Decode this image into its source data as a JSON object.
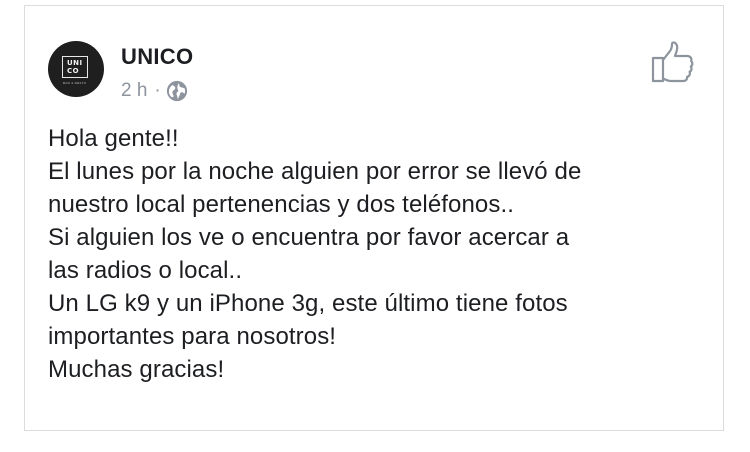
{
  "post": {
    "page_name": "UNICO",
    "timestamp": "2 h",
    "separator": "·",
    "privacy_icon": "globe-icon",
    "avatar": {
      "logo_line1": "UNI",
      "logo_line2": "CO",
      "logo_sub": "BAR & RESTO"
    },
    "like_icon": "thumbs-up-icon",
    "lines": [
      "Hola gente!!",
      "El lunes por la noche alguien por error se llevó de",
      "nuestro local pertenencias y dos teléfonos..",
      "Si alguien los ve o encuentra por favor acercar a",
      "las radios o local..",
      "Un LG k9 y un iPhone 3g, este último tiene fotos",
      "importantes para nosotros!",
      "Muchas gracias!"
    ]
  },
  "colors": {
    "text": "#1c1e21",
    "meta": "#8d949e",
    "border": "#dcdcdc",
    "avatar_bg": "#1f1f1f"
  }
}
